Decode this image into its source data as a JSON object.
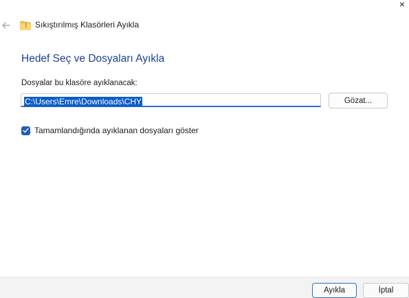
{
  "window": {
    "title": "Sıkıştırılmış Klasörleri Ayıkla",
    "close_glyph": "×"
  },
  "main": {
    "heading": "Hedef Seç ve Dosyaları Ayıkla",
    "destination_label": "Dosyalar bu klasöre ayıklanacak:",
    "destination_value": "C:\\Users\\Emre\\Downloads\\CHY",
    "browse_label": "Gözat...",
    "show_files_label": "Tamamlandığında ayıklanan dosyaları göster",
    "show_files_checked": true
  },
  "footer": {
    "extract_label": "Ayıkla",
    "cancel_label": "İptal"
  },
  "colors": {
    "heading": "#1f3f8f",
    "accent": "#2a6fc9",
    "selection": "#0a5cc8",
    "footer_bg": "#f3f3f3"
  },
  "icons": {
    "back": "arrow-left-icon",
    "folder": "compressed-folder-icon",
    "close": "close-icon",
    "check": "checkmark-icon"
  }
}
